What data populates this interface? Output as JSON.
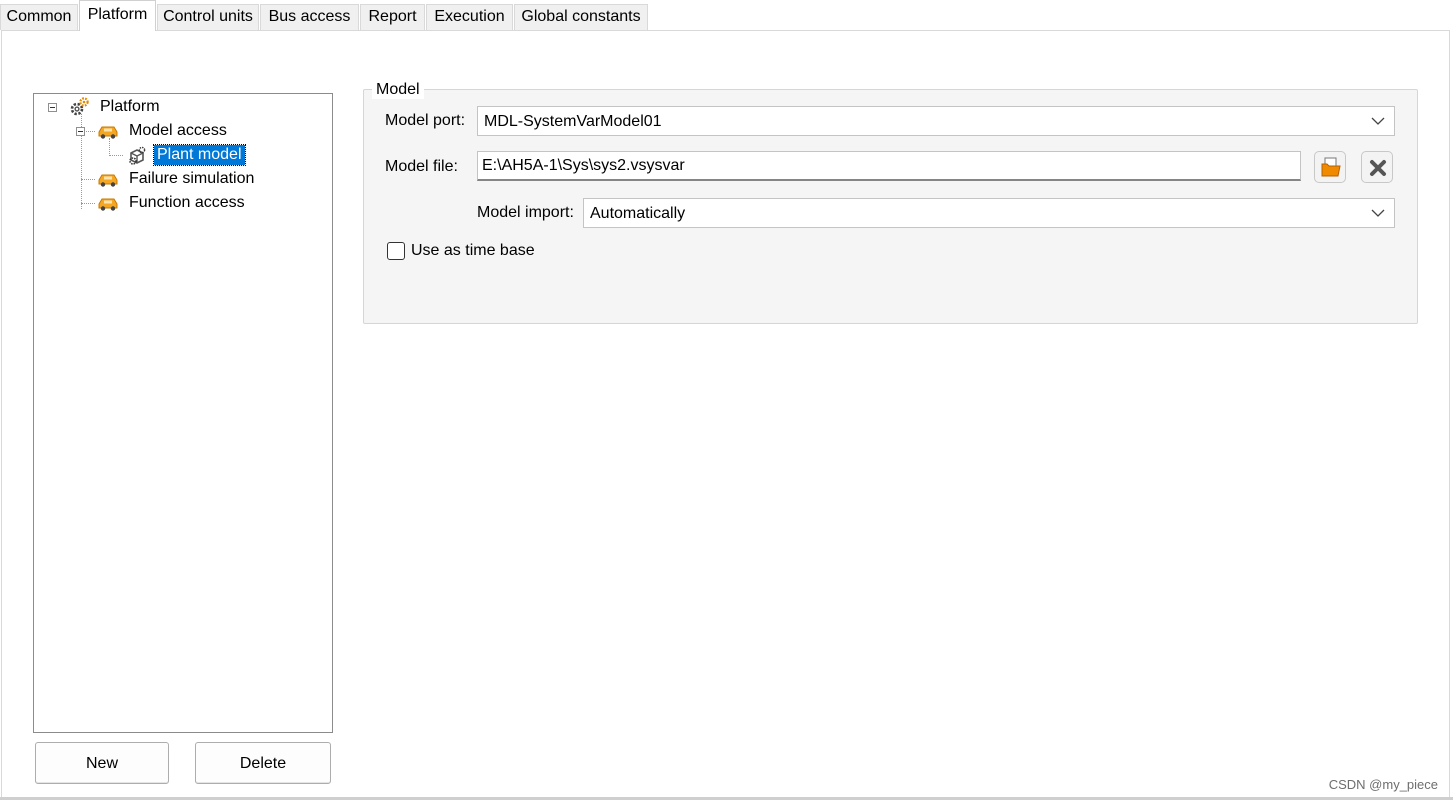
{
  "tabs": [
    {
      "label": "Common"
    },
    {
      "label": "Platform"
    },
    {
      "label": "Control units"
    },
    {
      "label": "Bus access"
    },
    {
      "label": "Report"
    },
    {
      "label": "Execution"
    },
    {
      "label": "Global constants"
    }
  ],
  "active_tab": "Platform",
  "tree": {
    "root": {
      "label": "Platform",
      "icon": "gears-icon",
      "expanded": true
    },
    "children": [
      {
        "label": "Model access",
        "icon": "car-icon",
        "expanded": true,
        "children": [
          {
            "label": "Plant model",
            "icon": "plant-model-icon",
            "selected": true
          }
        ]
      },
      {
        "label": "Failure simulation",
        "icon": "car-icon"
      },
      {
        "label": "Function access",
        "icon": "car-icon"
      }
    ]
  },
  "buttons": {
    "new_label": "New",
    "delete_label": "Delete"
  },
  "model_group": {
    "title": "Model",
    "port_label": "Model port:",
    "port_value": "MDL-SystemVarModel01",
    "file_label": "Model file:",
    "file_value": "E:\\AH5A-1\\Sys\\sys2.vsysvar",
    "import_label": "Model import:",
    "import_value": "Automatically",
    "time_base_label": "Use as time base",
    "time_base_checked": false
  },
  "colors": {
    "selection": "#0078d7",
    "car_orange": "#f5a623",
    "folder_orange": "#f08a00"
  },
  "watermark": "CSDN @my_piece"
}
